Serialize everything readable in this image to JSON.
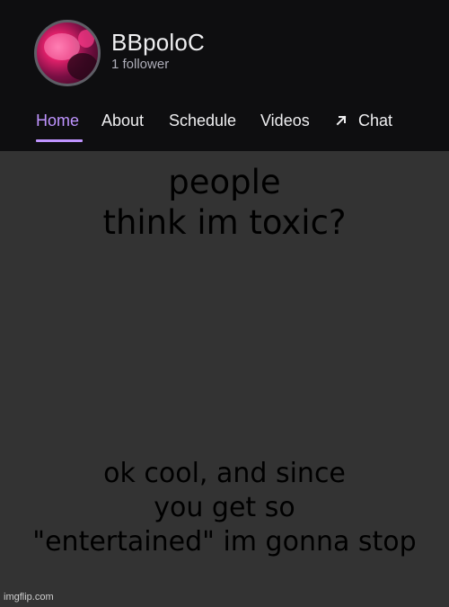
{
  "channel": {
    "name": "BBpoloC",
    "followers": "1 follower"
  },
  "nav": {
    "home": "Home",
    "about": "About",
    "schedule": "Schedule",
    "videos": "Videos",
    "chat": "Chat",
    "chat_icon": "arrow-up-right-icon",
    "active_color": "#bf94ff"
  },
  "meme": {
    "top_line1": "people",
    "top_line2": "think im toxic?",
    "bottom_line1": "ok cool, and since",
    "bottom_line2": "you get so",
    "bottom_line3": "\"entertained\" im gonna stop"
  },
  "watermark": "imgflip.com",
  "colors": {
    "header_bg": "#0e0e10",
    "body_bg": "#333333",
    "text_primary": "#efeff1"
  }
}
